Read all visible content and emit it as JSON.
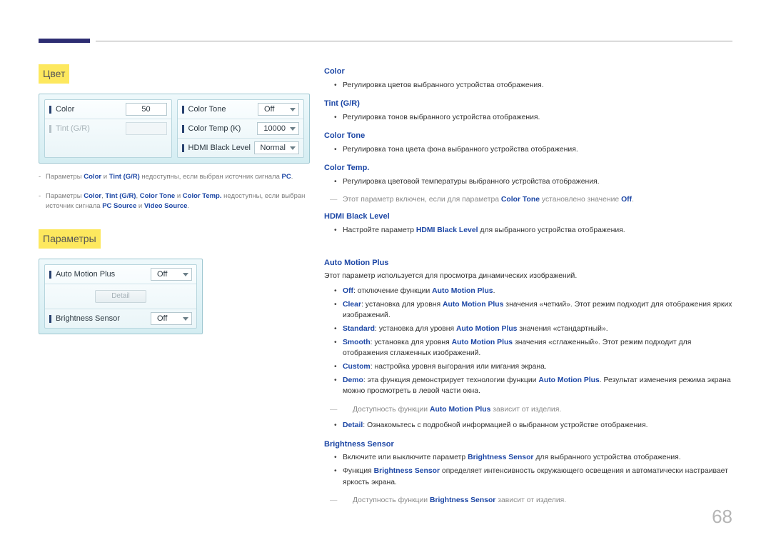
{
  "page_number": "68",
  "section_color": {
    "title": "Цвет"
  },
  "section_params": {
    "title": "Параметры"
  },
  "panel_color_left": [
    {
      "label": "Color",
      "value": "50",
      "dropdown": false,
      "disabled": false
    },
    {
      "label": "Tint (G/R)",
      "value": "",
      "dropdown": false,
      "disabled": true
    }
  ],
  "panel_color_right": [
    {
      "label": "Color Tone",
      "value": "Off",
      "dropdown": true
    },
    {
      "label": "Color Temp (K)",
      "value": "10000",
      "dropdown": true
    },
    {
      "label": "HDMI Black Level",
      "value": "Normal",
      "dropdown": true
    }
  ],
  "panel_params": [
    {
      "label": "Auto Motion Plus",
      "value": "Off",
      "dropdown": true,
      "type": "row"
    },
    {
      "label": "Detail",
      "type": "button_disabled"
    },
    {
      "label": "Brightness Sensor",
      "value": "Off",
      "dropdown": true,
      "type": "row"
    }
  ],
  "notes": [
    {
      "pre": "Параметры ",
      "b1": "Color",
      "mid1": " и ",
      "b2": "Tint (G/R)",
      "mid2": " недоступны, если выбран источник сигнала ",
      "b3": "PC",
      "post": "."
    },
    {
      "pre": "Параметры ",
      "b1": "Color",
      "mid1": ", ",
      "b2": "Tint (G/R)",
      "mid2": ", ",
      "b3": "Color Tone",
      "mid3": " и ",
      "b4": "Color Temp.",
      "mid4": " недоступны, если выбран источник сигнала ",
      "b5": "PC Source",
      "mid5": " и ",
      "b6": "Video Source",
      "post": "."
    }
  ],
  "right": {
    "color": {
      "h": "Color",
      "li": "Регулировка цветов выбранного устройства отображения."
    },
    "tint": {
      "h": "Tint (G/R)",
      "li": "Регулировка тонов выбранного устройства отображения."
    },
    "ctone": {
      "h": "Color Tone",
      "li": "Регулировка тона цвета фона выбранного устройства отображения."
    },
    "ctemp": {
      "h": "Color Temp.",
      "li": "Регулировка цветовой температуры выбранного устройства отображения.",
      "note_pre": "Этот параметр включен, если для параметра ",
      "note_b1": "Color Tone",
      "note_mid": " установлено значение ",
      "note_b2": "Off",
      "note_post": "."
    },
    "hbl": {
      "h": "HDMI Black Level",
      "li_pre": "Настройте параметр ",
      "li_b": "HDMI Black Level",
      "li_post": " для выбранного устройства отображения."
    },
    "amp": {
      "h": "Auto Motion Plus",
      "intro": "Этот параметр используется для просмотра динамических изображений.",
      "off_b": "Off",
      "off_mid": ": отключение функции ",
      "off_b2": "Auto Motion Plus",
      "off_post": ".",
      "clear_b": "Clear",
      "clear_mid": ": установка для уровня ",
      "clear_b2": "Auto Motion Plus",
      "clear_post": " значения «четкий». Этот режим подходит для отображения ярких изображений.",
      "std_b": "Standard",
      "std_mid": ": установка для уровня ",
      "std_b2": "Auto Motion Plus",
      "std_post": " значения «стандартный».",
      "smooth_b": "Smooth",
      "smooth_mid": ": установка для уровня ",
      "smooth_b2": "Auto Motion Plus",
      "smooth_post": " значения «сглаженный». Этот режим подходит для отображения сглаженных изображений.",
      "custom_b": "Custom",
      "custom_post": ": настройка уровня выгорания или мигания экрана.",
      "demo_b": "Demo",
      "demo_mid": ": эта функция демонстрирует технологии функции ",
      "demo_b2": "Auto Motion Plus",
      "demo_post": ". Результат изменения режима экрана можно просмотреть в левой части окна.",
      "avail_pre": "Доступность функции ",
      "avail_b": "Auto Motion Plus",
      "avail_post": " зависит от изделия.",
      "detail_b": "Detail",
      "detail_post": ": Ознакомьтесь с подробной информацией о выбранном устройстве отображения."
    },
    "bs": {
      "h": "Brightness Sensor",
      "li1_pre": "Включите или выключите параметр ",
      "li1_b": "Brightness Sensor",
      "li1_post": " для выбранного устройства отображения.",
      "li2_pre": "Функция ",
      "li2_b": "Brightness Sensor",
      "li2_post": " определяет интенсивность окружающего освещения и автоматически настраивает яркость экрана.",
      "avail_pre": "Доступность функции ",
      "avail_b": "Brightness Sensor",
      "avail_post": " зависит от изделия."
    }
  }
}
